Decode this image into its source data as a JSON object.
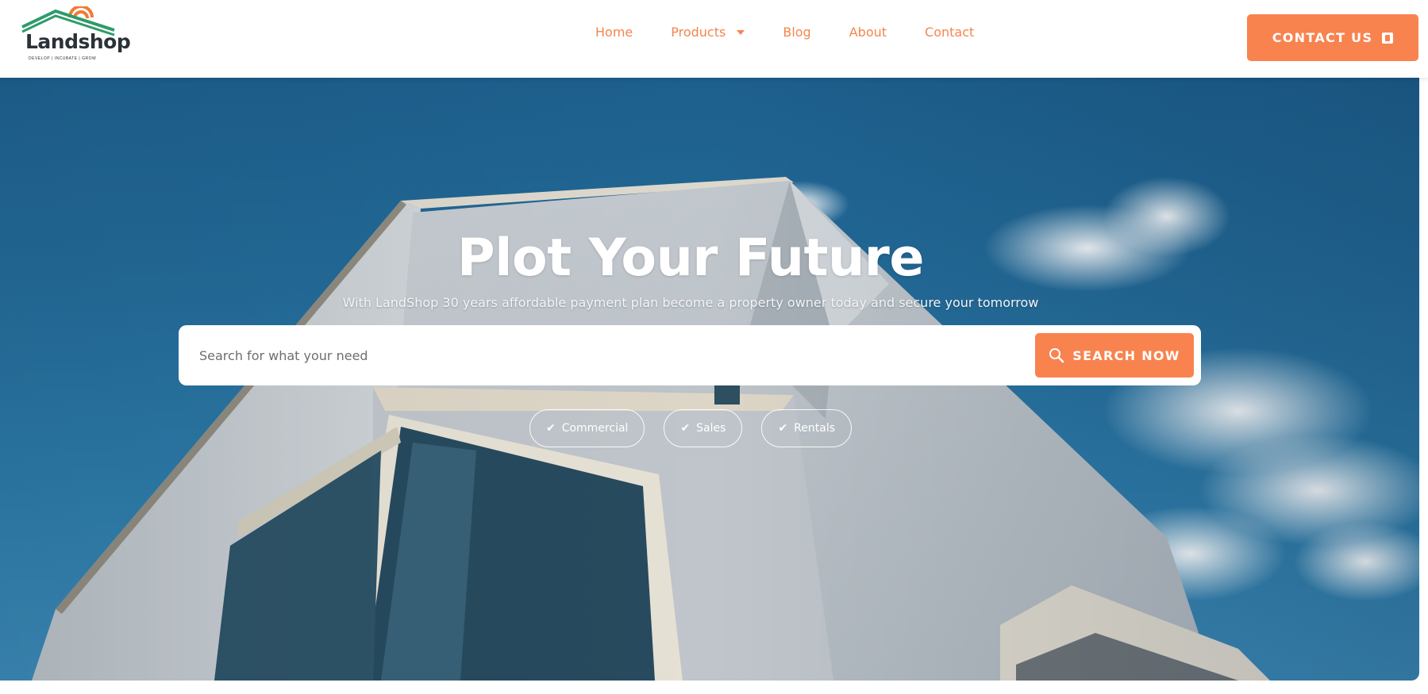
{
  "brand": {
    "name": "Landshop",
    "tagline": "DEVELOP | INCUBATE | GROW",
    "colors": {
      "accent": "#f8834f",
      "logo_green": "#2e9b6b",
      "logo_orange": "#f07a36"
    }
  },
  "nav": {
    "items": [
      {
        "label": "Home"
      },
      {
        "label": "Products",
        "has_dropdown": true
      },
      {
        "label": "Blog"
      },
      {
        "label": "About"
      },
      {
        "label": "Contact"
      }
    ]
  },
  "header": {
    "contact_button": {
      "label": "CONTACT US",
      "icon": "phone-icon"
    }
  },
  "hero": {
    "title": "Plot Your Future",
    "subtitle": "With LandShop 30 years affordable payment plan become a property owner today and secure your tomorrow",
    "search": {
      "placeholder": "Search for what your need",
      "value": "",
      "button_label": "SEARCH NOW",
      "button_icon": "search-icon"
    },
    "filters": [
      {
        "label": "Commercial",
        "icon": "check-icon"
      },
      {
        "label": "Sales",
        "icon": "check-icon"
      },
      {
        "label": "Rentals",
        "icon": "check-icon"
      }
    ]
  }
}
